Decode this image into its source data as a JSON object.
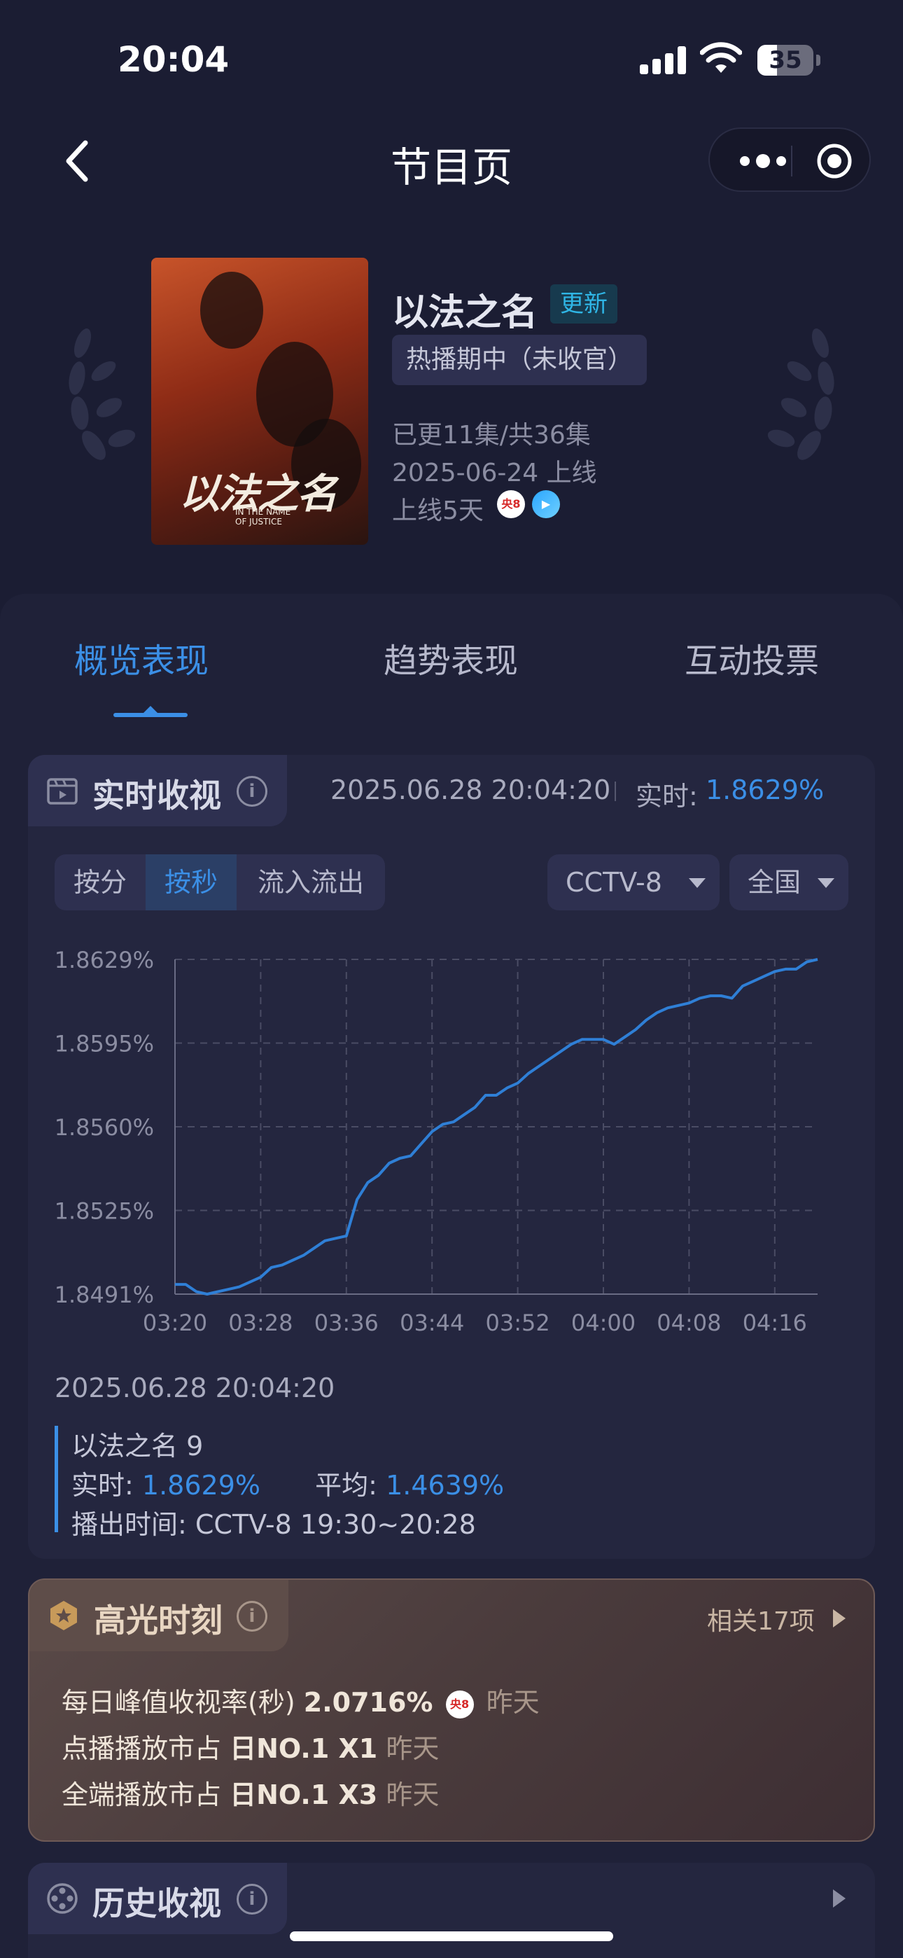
{
  "status_bar": {
    "time": "20:04",
    "battery": "35"
  },
  "nav": {
    "title": "节目页"
  },
  "program": {
    "title": "以法之名",
    "badge": "更新",
    "status": "热播期中（未收官）",
    "episodes": "已更11集/共36集",
    "premiere": "2025-06-24 上线",
    "days_online": "上线5天",
    "channel_badge": "央8",
    "poster_title": "以法之名",
    "poster_subtitle": "IN THE NAME OF JUSTICE"
  },
  "tabs": [
    {
      "label": "概览表现",
      "active": true
    },
    {
      "label": "趋势表现",
      "active": false
    },
    {
      "label": "互动投票",
      "active": false
    }
  ],
  "realtime": {
    "section_title": "实时收视",
    "timestamp": "2025.06.28 20:04:20",
    "label": "实时:",
    "value": "1.8629%",
    "segments": [
      "按分",
      "按秒",
      "流入流出"
    ],
    "active_segment": "按秒",
    "channel_select": "CCTV-8",
    "region_select": "全国"
  },
  "chart_data": {
    "type": "line",
    "y_ticks": [
      "1.8629%",
      "1.8595%",
      "1.8560%",
      "1.8525%",
      "1.8491%"
    ],
    "x_ticks": [
      "03:20",
      "03:28",
      "03:36",
      "03:44",
      "03:52",
      "04:00",
      "04:08",
      "04:16"
    ],
    "ylim": [
      1.8491,
      1.8629
    ],
    "xlim": [
      0,
      60
    ],
    "x_unit": "seconds-minutes (MM:SS)",
    "grid": true,
    "color": "#2f7fd6",
    "x": [
      0,
      1,
      2,
      3,
      4,
      5,
      6,
      7,
      8,
      9,
      10,
      11,
      12,
      13,
      14,
      15,
      16,
      17,
      18,
      19,
      20,
      21,
      22,
      23,
      24,
      25,
      26,
      27,
      28,
      29,
      30,
      31,
      32,
      33,
      34,
      35,
      36,
      37,
      38,
      39,
      40,
      41,
      42,
      43,
      44,
      45,
      46,
      47,
      48,
      49,
      50,
      51,
      52,
      53,
      54,
      55,
      56,
      57,
      58,
      59,
      60
    ],
    "y": [
      1.8495,
      1.8495,
      1.8492,
      1.8491,
      1.8492,
      1.8493,
      1.8494,
      1.8496,
      1.8498,
      1.8502,
      1.8503,
      1.8505,
      1.8507,
      1.851,
      1.8513,
      1.8514,
      1.8515,
      1.853,
      1.8537,
      1.854,
      1.8545,
      1.8547,
      1.8548,
      1.8553,
      1.8558,
      1.8561,
      1.8562,
      1.8565,
      1.8568,
      1.8573,
      1.8573,
      1.8576,
      1.8578,
      1.8582,
      1.8585,
      1.8588,
      1.8591,
      1.8594,
      1.8596,
      1.8596,
      1.8596,
      1.8594,
      1.8597,
      1.86,
      1.8604,
      1.8607,
      1.8609,
      1.861,
      1.8611,
      1.8613,
      1.8614,
      1.8614,
      1.8613,
      1.8618,
      1.862,
      1.8622,
      1.8624,
      1.8625,
      1.8625,
      1.8628,
      1.8629
    ]
  },
  "detail": {
    "timestamp": "2025.06.28 20:04:20",
    "episode": "以法之名 9",
    "realtime_label": "实时:",
    "realtime_value": "1.8629%",
    "avg_label": "平均:",
    "avg_value": "1.4639%",
    "airtime": "播出时间:  CCTV-8 19:30~20:28"
  },
  "highlights": {
    "section_title": "高光时刻",
    "more": "相关17项",
    "rows": [
      {
        "label": "每日峰值收视率(秒)",
        "value": "2.0716%",
        "when": "昨天",
        "channel": "央8"
      },
      {
        "label": "点播播放市占",
        "value": "日NO.1 X1",
        "when": "昨天"
      },
      {
        "label": "全端播放市占",
        "value": "日NO.1 X3",
        "when": "昨天"
      }
    ]
  },
  "history": {
    "section_title": "历史收视"
  },
  "icons": [
    "back-icon",
    "more-icon",
    "target-icon",
    "info-icon",
    "tv-icon",
    "star-badge-icon",
    "film-reel-icon",
    "laurel-icon",
    "play-arrow-icon"
  ]
}
